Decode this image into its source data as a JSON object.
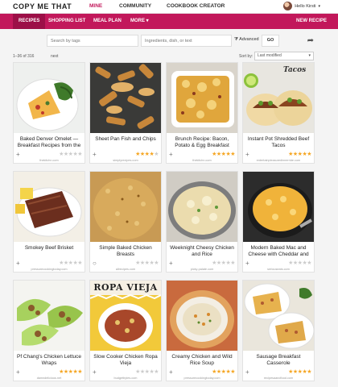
{
  "app": {
    "logo": "COPY ME THAT",
    "nav": [
      "MINE",
      "COMMUNITY",
      "COOKBOOK CREATOR"
    ],
    "user": "Hello Kirsti"
  },
  "subnav": {
    "tabs": [
      "RECIPES",
      "SHOPPING LIST",
      "MEAL PLAN",
      "MORE ▾"
    ],
    "new_recipe": "NEW RECIPE"
  },
  "search": {
    "tags_placeholder": "Search by tags",
    "text_placeholder": "Ingredients, dish, or text",
    "advanced": "Advanced",
    "go": "GO"
  },
  "listing": {
    "count": "1–36 of 316",
    "next": "next",
    "sort_label": "Sort by:",
    "sort_value": "Last modified"
  },
  "colors": {
    "brand": "#c2185b",
    "brand_dark": "#9c0f47",
    "star": "#f5a623"
  },
  "recipes": [
    {
      "title": "Baked Denver Omelet — Breakfast Recipes from the",
      "source": "thekitchn.com",
      "rating": 0,
      "action": "plus",
      "image": "omelet-plate"
    },
    {
      "title": "Sheet Pan Fish and Chips",
      "source": "simplyrecipes.com",
      "rating": 4,
      "action": "plus",
      "image": "fish-chips"
    },
    {
      "title": "Brunch Recipe: Bacon, Potato & Egg Breakfast",
      "source": "thekitchn.com",
      "rating": 5,
      "action": "plus",
      "image": "bacon-casserole"
    },
    {
      "title": "Instant Pot Shredded Beef Tacos",
      "source": "entertainpleasuredinnerride.com",
      "rating": 5,
      "action": "plus",
      "image": "beef-tacos",
      "image_text": "Tacos"
    },
    {
      "title": "Smokey Beef Brisket",
      "source": "pressurecookingtoday.com",
      "rating": 0,
      "action": "plus",
      "image": "beef-brisket"
    },
    {
      "title": "Simple Baked Chicken Breasts",
      "source": "allrecipes.com",
      "rating": 0,
      "action": "circle",
      "image": "baked-chicken"
    },
    {
      "title": "Weeknight Cheesy Chicken and Rice",
      "source": "picky-palate.com",
      "rating": 0,
      "action": "plus",
      "image": "cheesy-chicken-rice"
    },
    {
      "title": "Modern Baked Mac and Cheese with Cheddar and",
      "source": "seriouseats.com",
      "rating": 0,
      "action": "plus",
      "image": "mac-cheese"
    },
    {
      "title": "Pf Chang's Chicken Lettuce Wraps",
      "source": "damndelicious.net",
      "rating": 5,
      "action": "plus",
      "image": "lettuce-wraps"
    },
    {
      "title": "Slow Cooker Chicken Ropa Vieja",
      "source": "budgetbytes.com",
      "rating": 0,
      "action": "plus",
      "image": "ropa-vieja",
      "image_text": "ROPA VIEJA"
    },
    {
      "title": "Creamy Chicken and Wild Rice Soup",
      "source": "pressurecookingtoday.com",
      "rating": 5,
      "action": "plus",
      "image": "rice-soup"
    },
    {
      "title": "Sausage Breakfast Casserole",
      "source": "recipesaandfood.com",
      "rating": 5,
      "action": "plus",
      "image": "sausage-casserole"
    }
  ]
}
